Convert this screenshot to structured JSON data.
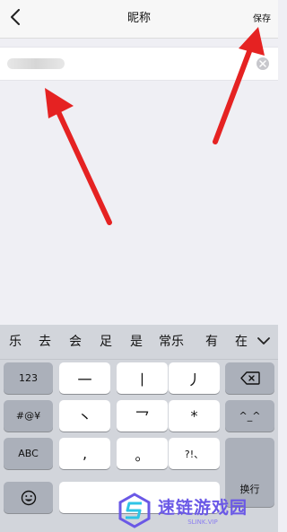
{
  "navbar": {
    "back_icon": "chevron-left-icon",
    "title": "昵称",
    "save_label": "保存"
  },
  "nickname_input": {
    "value": "",
    "placeholder": ""
  },
  "candidates": [
    "乐",
    "去",
    "会",
    "足",
    "是",
    "常乐",
    "有",
    "在"
  ],
  "keyboard": {
    "left_column": [
      "123",
      "#@¥",
      "ABC"
    ],
    "row1": [
      "一",
      "丨",
      "丿"
    ],
    "row2": [
      "丶",
      "乛",
      "*"
    ],
    "row3": [
      ",",
      "。",
      "?!、"
    ],
    "right_column": {
      "backspace_icon": "backspace-icon",
      "emoticon": "^_^",
      "return": "换行"
    },
    "emoji_icon": "emoji-icon",
    "space": ""
  },
  "watermark": {
    "title": "速链游戏园",
    "subtitle": "SLINK.VIP"
  },
  "colors": {
    "arrow": "#e52222",
    "watermark": "#6a58e6"
  }
}
